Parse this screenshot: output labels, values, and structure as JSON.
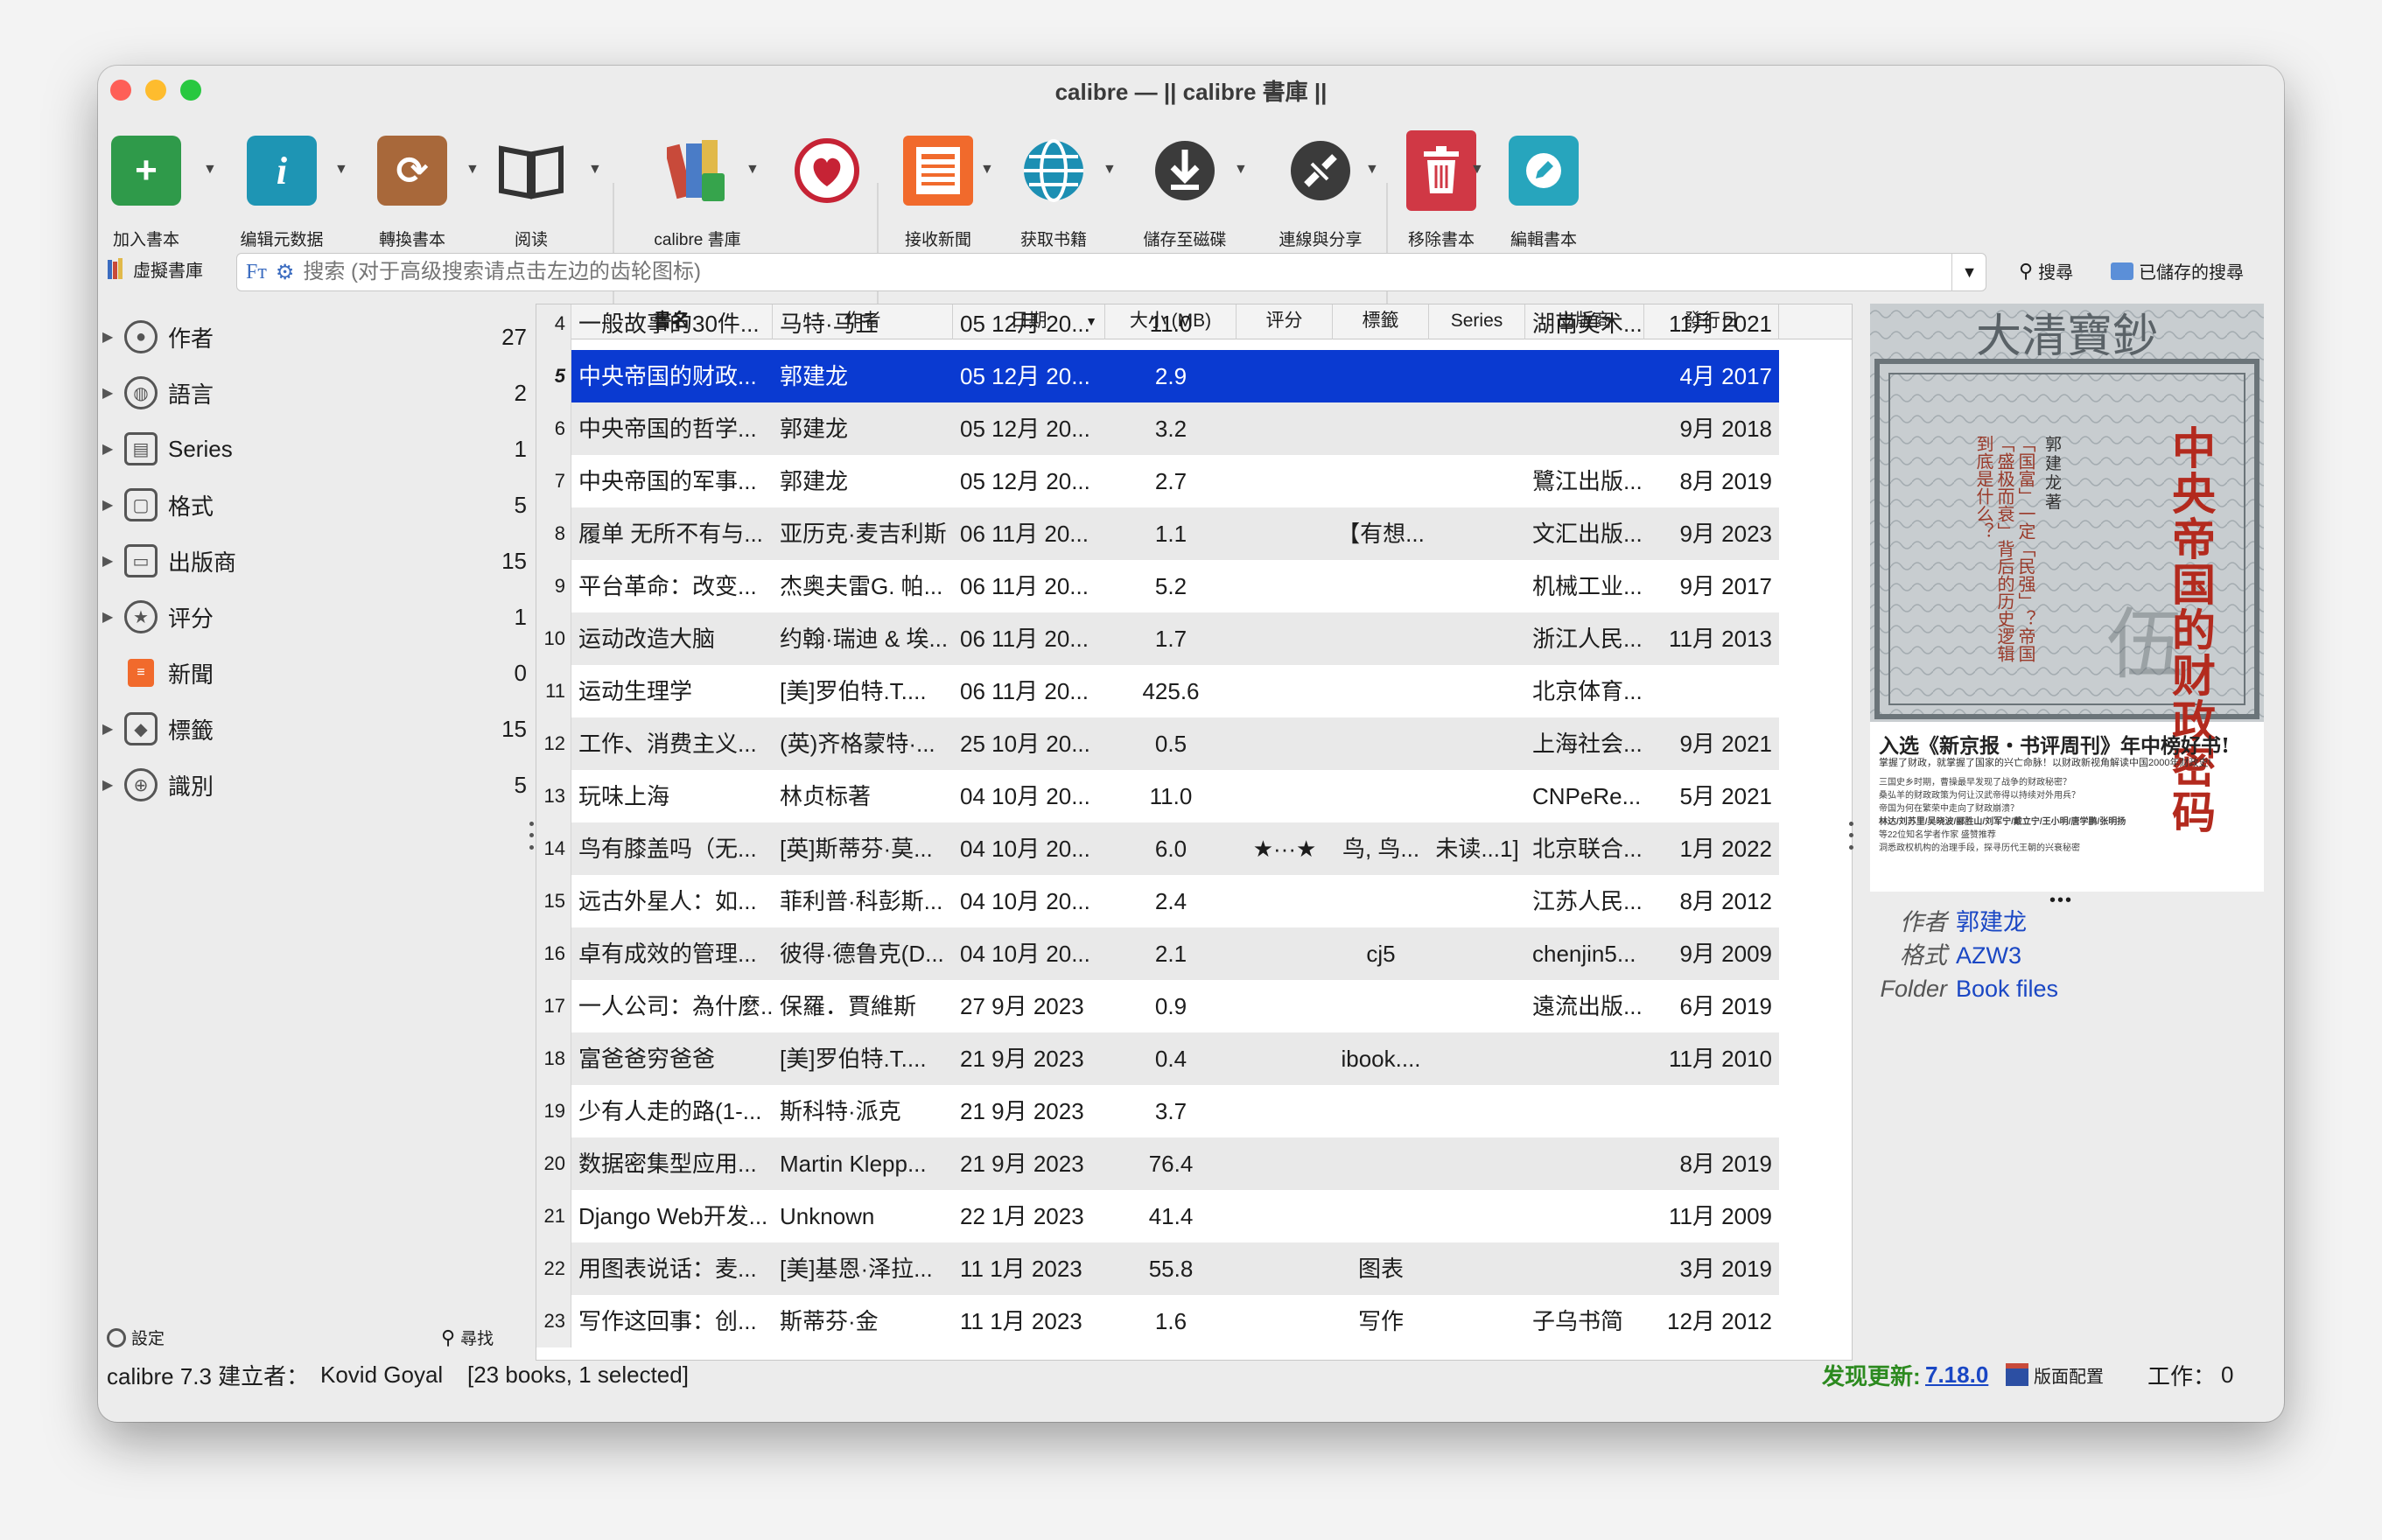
{
  "window": {
    "title": "calibre — || calibre 書庫 ||"
  },
  "toolbar": {
    "buttons": [
      {
        "label": "加入書本",
        "icon": "add-book-icon"
      },
      {
        "label": "编辑元数据",
        "icon": "edit-metadata-icon"
      },
      {
        "label": "轉換書本",
        "icon": "convert-books-icon"
      },
      {
        "label": "阅读",
        "icon": "read-book-icon"
      },
      {
        "label": "calibre 書庫",
        "icon": "library-icon"
      },
      {
        "label": "",
        "icon": "donate-heart-icon"
      },
      {
        "label": "接收新聞",
        "icon": "fetch-news-icon"
      },
      {
        "label": "获取书籍",
        "icon": "get-books-icon"
      },
      {
        "label": "儲存至磁碟",
        "icon": "save-to-disk-icon"
      },
      {
        "label": "連線與分享",
        "icon": "connect-share-icon"
      },
      {
        "label": "移除書本",
        "icon": "remove-books-icon"
      },
      {
        "label": "編輯書本",
        "icon": "edit-book-icon"
      }
    ]
  },
  "search": {
    "virtual_library": "虛擬書庫",
    "placeholder": "搜索 (对于高级搜索请点击左边的齿轮图标)",
    "search_button": "搜尋",
    "saved_searches": "已儲存的搜尋"
  },
  "tag_browser": {
    "items": [
      {
        "label": "作者",
        "count": "27",
        "icon": "person-icon"
      },
      {
        "label": "語言",
        "count": "2",
        "icon": "globe-icon"
      },
      {
        "label": "Series",
        "count": "1",
        "icon": "series-icon"
      },
      {
        "label": "格式",
        "count": "5",
        "icon": "format-icon"
      },
      {
        "label": "出版商",
        "count": "15",
        "icon": "publisher-icon"
      },
      {
        "label": "评分",
        "count": "1",
        "icon": "star-icon"
      },
      {
        "label": "新聞",
        "count": "0",
        "icon": "news-icon"
      },
      {
        "label": "標籤",
        "count": "15",
        "icon": "tag-icon"
      },
      {
        "label": "識別",
        "count": "5",
        "icon": "identifier-icon"
      }
    ],
    "settings": "設定",
    "find": "尋找"
  },
  "book_list": {
    "columns": [
      "書名",
      "作者",
      "日期",
      "大小 (MB)",
      "评分",
      "標籤",
      "Series",
      "出版商",
      "發行日"
    ],
    "partial_row": {
      "num": "4",
      "title": "一般故事的30件...",
      "author": "马特·马丘",
      "date": "05 12月 20...",
      "size": "11.0",
      "publisher": "湖南美术...",
      "pubdate": "11月 2021"
    },
    "rows": [
      {
        "num": "5",
        "title": "中央帝国的财政...",
        "author": "郭建龙",
        "date": "05 12月 20...",
        "size": "2.9",
        "rating": "",
        "tags": "",
        "series": "",
        "publisher": "",
        "pubdate": "4月 2017",
        "selected": true
      },
      {
        "num": "6",
        "title": "中央帝国的哲学...",
        "author": "郭建龙",
        "date": "05 12月 20...",
        "size": "3.2",
        "rating": "",
        "tags": "",
        "series": "",
        "publisher": "",
        "pubdate": "9月 2018"
      },
      {
        "num": "7",
        "title": "中央帝国的军事...",
        "author": "郭建龙",
        "date": "05 12月 20...",
        "size": "2.7",
        "rating": "",
        "tags": "",
        "series": "",
        "publisher": "鷺江出版...",
        "pubdate": "8月 2019"
      },
      {
        "num": "8",
        "title": "履单 无所不有与...",
        "author": "亚历克·麦吉利斯",
        "date": "06 11月 20...",
        "size": "1.1",
        "rating": "",
        "tags": "【有想...",
        "series": "",
        "publisher": "文汇出版...",
        "pubdate": "9月 2023"
      },
      {
        "num": "9",
        "title": "平台革命：改变...",
        "author": "杰奥夫雷G. 帕...",
        "date": "06 11月 20...",
        "size": "5.2",
        "rating": "",
        "tags": "",
        "series": "",
        "publisher": "机械工业...",
        "pubdate": "9月 2017"
      },
      {
        "num": "10",
        "title": "运动改造大脑",
        "author": "约翰·瑞迪 & 埃...",
        "date": "06 11月 20...",
        "size": "1.7",
        "rating": "",
        "tags": "",
        "series": "",
        "publisher": "浙江人民...",
        "pubdate": "11月 2013"
      },
      {
        "num": "11",
        "title": "运动生理学",
        "author": "[美]罗伯特.T....",
        "date": "06 11月 20...",
        "size": "425.6",
        "rating": "",
        "tags": "",
        "series": "",
        "publisher": "北京体育...",
        "pubdate": ""
      },
      {
        "num": "12",
        "title": "工作、消费主义...",
        "author": "(英)齐格蒙特·...",
        "date": "25 10月 20...",
        "size": "0.5",
        "rating": "",
        "tags": "",
        "series": "",
        "publisher": "上海社会...",
        "pubdate": "9月 2021"
      },
      {
        "num": "13",
        "title": "玩味上海",
        "author": "林贞标著",
        "date": "04 10月 20...",
        "size": "11.0",
        "rating": "",
        "tags": "",
        "series": "",
        "publisher": "CNPeRe...",
        "pubdate": "5月 2021"
      },
      {
        "num": "14",
        "title": "鸟有膝盖吗（无...",
        "author": "[英]斯蒂芬·莫...",
        "date": "04 10月 20...",
        "size": "6.0",
        "rating": "★···★",
        "tags": "鸟, 鸟...",
        "series": "未读...1]",
        "publisher": "北京联合...",
        "pubdate": "1月 2022"
      },
      {
        "num": "15",
        "title": "远古外星人：如...",
        "author": "菲利普·科彭斯...",
        "date": "04 10月 20...",
        "size": "2.4",
        "rating": "",
        "tags": "",
        "series": "",
        "publisher": "江苏人民...",
        "pubdate": "8月 2012"
      },
      {
        "num": "16",
        "title": "卓有成效的管理...",
        "author": "彼得·德鲁克(D...",
        "date": "04 10月 20...",
        "size": "2.1",
        "rating": "",
        "tags": "cj5",
        "series": "",
        "publisher": "chenjin5...",
        "pubdate": "9月 2009"
      },
      {
        "num": "17",
        "title": "一人公司：為什麼...",
        "author": "保羅．賈維斯",
        "date": "27 9月 2023",
        "size": "0.9",
        "rating": "",
        "tags": "",
        "series": "",
        "publisher": "遠流出版...",
        "pubdate": "6月 2019"
      },
      {
        "num": "18",
        "title": "富爸爸穷爸爸",
        "author": "[美]罗伯特.T....",
        "date": "21 9月 2023",
        "size": "0.4",
        "rating": "",
        "tags": "ibook....",
        "series": "",
        "publisher": "",
        "pubdate": "11月 2010"
      },
      {
        "num": "19",
        "title": "少有人走的路(1-...",
        "author": "斯科特·派克",
        "date": "21 9月 2023",
        "size": "3.7",
        "rating": "",
        "tags": "",
        "series": "",
        "publisher": "",
        "pubdate": ""
      },
      {
        "num": "20",
        "title": "数据密集型应用...",
        "author": "Martin Klepp...",
        "date": "21 9月 2023",
        "size": "76.4",
        "rating": "",
        "tags": "",
        "series": "",
        "publisher": "",
        "pubdate": "8月 2019"
      },
      {
        "num": "21",
        "title": "Django Web开发...",
        "author": "Unknown",
        "date": "22 1月 2023",
        "size": "41.4",
        "rating": "",
        "tags": "",
        "series": "",
        "publisher": "",
        "pubdate": "11月 2009"
      },
      {
        "num": "22",
        "title": "用图表说话：麦...",
        "author": "[美]基恩·泽拉...",
        "date": "11 1月 2023",
        "size": "55.8",
        "rating": "",
        "tags": "图表",
        "series": "",
        "publisher": "",
        "pubdate": "3月 2019"
      },
      {
        "num": "23",
        "title": "写作这回事：创...",
        "author": "斯蒂芬·金",
        "date": "11 1月 2023",
        "size": "1.6",
        "rating": "",
        "tags": "写作",
        "series": "",
        "publisher": "子乌书简",
        "pubdate": "12月 2012"
      }
    ]
  },
  "cover": {
    "title": "中央帝国的财政密码",
    "author": "郭建龙 著",
    "subtitle": "「国富」一定「民强」？帝国「盛极而衰」背后的历史逻辑到底是什么？",
    "banner": "入选《新京报・书评周刊》年中榜好书!",
    "blurb": "掌握了财政，就掌握了国家的兴亡命脉！以财政新视角解读中国2000年财政史!",
    "small_lines": [
      "三国史乡时期，曹操最早发现了战争的财政秘密？",
      "桑弘羊的财政政策为何让汉武帝得以持续对外用兵？",
      "帝国为何在繁荣中走向了财政崩溃？",
      "林达/刘苏里/吴晓波/郦胜山/刘军宁/戴立宁/王小明/唐学鹏/张明扬",
      "等22位知名学者作家 盛赞推荐",
      "洞悉政权机构的治理手段，探寻历代王朝的兴衰秘密"
    ],
    "seal_text": "大清寶鈔"
  },
  "details": {
    "author_key": "作者",
    "author_val": "郭建龙",
    "format_key": "格式",
    "format_val": "AZW3",
    "folder_key": "Folder",
    "folder_val": "Book files"
  },
  "status": {
    "version": "calibre 7.3 建立者：",
    "creator": "Kovid Goyal",
    "count": "[23 books, 1 selected]",
    "update_label": "发现更新:",
    "update_version": "7.18.0",
    "layout": "版面配置",
    "jobs": "工作：",
    "jobs_count": "0"
  },
  "colors": {
    "selection": "#0a3ad1",
    "link": "#1a47c4",
    "update": "#2c8a1f"
  }
}
